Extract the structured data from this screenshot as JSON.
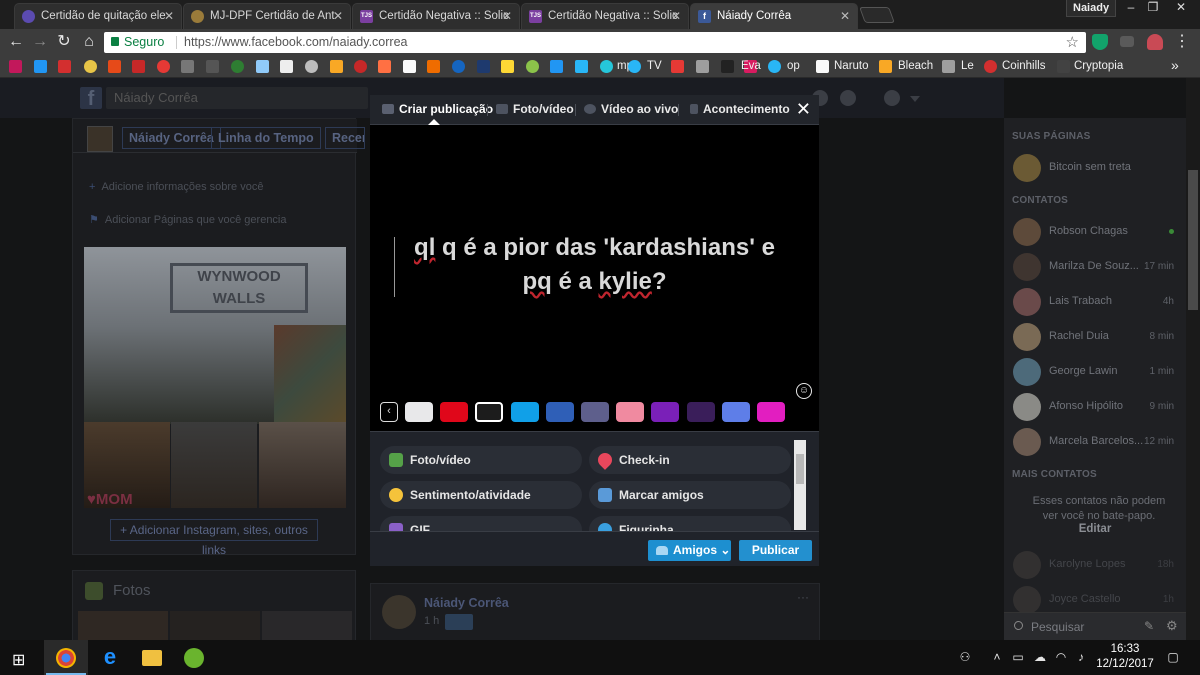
{
  "browser": {
    "tabs": [
      {
        "title": "Certidão de quitação ele",
        "fav_color": "#5b4bb0",
        "fav_text": ""
      },
      {
        "title": "MJ-DPF Certidão de Ant",
        "fav_color": "#9a7b3a",
        "fav_text": ""
      },
      {
        "title": "Certidão Negativa :: Solic",
        "fav_color": "#7b3fa0",
        "fav_text": "TJS"
      },
      {
        "title": "Certidão Negativa :: Solic",
        "fav_color": "#7b3fa0",
        "fav_text": "TJS"
      },
      {
        "title": "Náiady Corrêa",
        "fav_color": "#3b5998",
        "fav_text": "f"
      }
    ],
    "profile_name": "Naiady",
    "secure_label": "Seguro",
    "url": "https://www.facebook.com/naiady.correa",
    "bookmarks": [
      "mp3",
      "TV",
      "Eva",
      "op",
      "Naruto",
      "Bleach",
      "Le",
      "Coinhills",
      "Cryptopia"
    ]
  },
  "facebook": {
    "search_placeholder": "Náiady Corrêa",
    "timeline_tabs": [
      "Náiady Corrêa",
      "Linha do Tempo",
      "Recente"
    ],
    "intro_lines": [
      "Adicione informações sobre você",
      "Adicionar Páginas que você gerencia"
    ],
    "photo_sign": "WYNWOOD WALLS",
    "photo_caption": "MOM",
    "add_links": "Adicionar Instagram, sites, outros links",
    "photos_title": "Fotos",
    "post_author": "Náiady Corrêa",
    "post_time": "1 h"
  },
  "composer": {
    "tabs": [
      "Criar publicação",
      "Foto/vídeo",
      "Vídeo ao vivo",
      "Acontecimento"
    ],
    "text_line1": "ql q é a pior das 'kardashians' e",
    "text_line2_a": "pq",
    "text_line2_b": " é a ",
    "text_line2_c": "kylie",
    "text_line2_d": "?",
    "swatches": [
      "#e8e8ea",
      "#e0071a",
      "#1c1c1c",
      "#10a0e8",
      "#2f5fb7",
      "#5e5f8c",
      "#f08aa0",
      "#7a20b8",
      "#3a1e5a",
      "#5e7ee8",
      "#e21ec0"
    ],
    "options": [
      {
        "label": "Foto/vídeo",
        "icon": "photo-icon",
        "color": "#55a148"
      },
      {
        "label": "Check-in",
        "icon": "location-pin-icon",
        "color": "#e9475c"
      },
      {
        "label": "Sentimento/atividade",
        "icon": "smiley-icon",
        "color": "#f5c33b"
      },
      {
        "label": "Marcar amigos",
        "icon": "tag-friends-icon",
        "color": "#5a9ad8"
      },
      {
        "label": "GIF",
        "icon": "gif-icon",
        "color": "#8a60c8"
      },
      {
        "label": "Figurinha",
        "icon": "sticker-icon",
        "color": "#3aa0e0"
      }
    ],
    "audience_label": "Amigos",
    "publish_label": "Publicar"
  },
  "sidebar": {
    "your_pages_header": "SUAS PÁGINAS",
    "your_page": "Bitcoin sem treta",
    "contacts_header": "CONTATOS",
    "contacts": [
      {
        "name": "Robson Chagas",
        "time": ""
      },
      {
        "name": "Marilza De Souz...",
        "time": "17 min"
      },
      {
        "name": "Lais Trabach",
        "time": "4h"
      },
      {
        "name": "Rachel Duia",
        "time": "8 min"
      },
      {
        "name": "George Lawin",
        "time": "1 min"
      },
      {
        "name": "Afonso Hipólito",
        "time": "9 min"
      },
      {
        "name": "Marcela Barcelos...",
        "time": "12 min"
      }
    ],
    "more_contacts_header": "MAIS CONTATOS",
    "more_contacts_msg": "Esses contatos não podem ver você no bate-papo.",
    "edit_label": "Editar",
    "faded_contacts": [
      {
        "name": "Karolyne Lopes",
        "time": "18h"
      },
      {
        "name": "Joyce Castello",
        "time": "1h"
      }
    ],
    "search_placeholder": "Pesquisar"
  },
  "taskbar": {
    "time": "16:33",
    "date": "12/12/2017"
  }
}
